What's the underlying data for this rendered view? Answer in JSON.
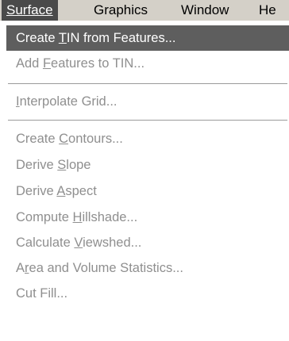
{
  "menubar": {
    "items": [
      {
        "label": "Surface",
        "active": true
      },
      {
        "label": "Graphics",
        "active": false
      },
      {
        "label": "Window",
        "active": false
      },
      {
        "label": "He",
        "active": false
      }
    ]
  },
  "dropdown": {
    "items": [
      {
        "pre": "Create ",
        "acc": "T",
        "post": "IN from Features...",
        "enabled": true,
        "highlighted": true
      },
      {
        "pre": "Add ",
        "acc": "F",
        "post": "eatures to TIN...",
        "enabled": false,
        "highlighted": false
      },
      {
        "pre": "",
        "acc": "I",
        "post": "nterpolate Grid...",
        "enabled": false,
        "highlighted": false
      },
      {
        "pre": "Create ",
        "acc": "C",
        "post": "ontours...",
        "enabled": false,
        "highlighted": false
      },
      {
        "pre": "Derive ",
        "acc": "S",
        "post": "lope",
        "enabled": false,
        "highlighted": false
      },
      {
        "pre": "Derive ",
        "acc": "A",
        "post": "spect",
        "enabled": false,
        "highlighted": false
      },
      {
        "pre": "Compute ",
        "acc": "H",
        "post": "illshade...",
        "enabled": false,
        "highlighted": false
      },
      {
        "pre": "Calculate ",
        "acc": "V",
        "post": "iewshed...",
        "enabled": false,
        "highlighted": false
      },
      {
        "pre": "A",
        "acc": "r",
        "post": "ea and Volume Statistics...",
        "enabled": false,
        "highlighted": false
      },
      {
        "pre": "Cut Fill...",
        "acc": "",
        "post": "",
        "enabled": false,
        "highlighted": false
      }
    ]
  }
}
